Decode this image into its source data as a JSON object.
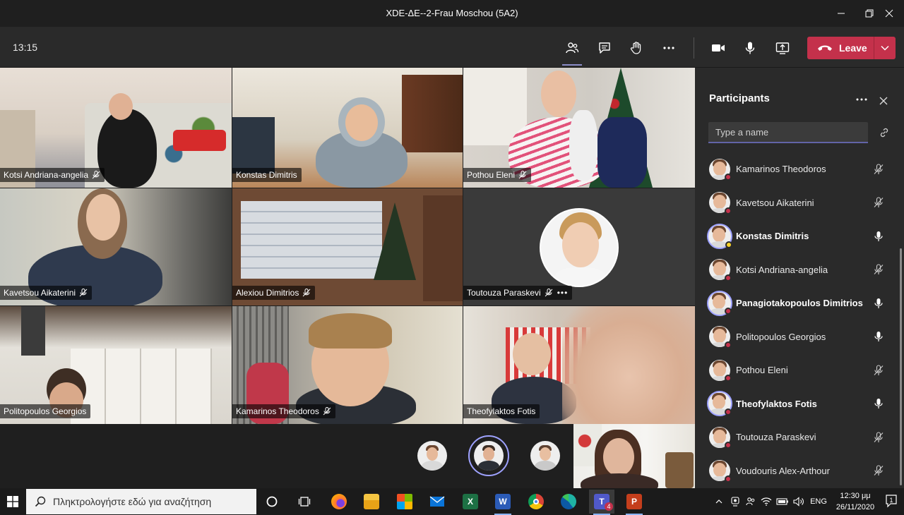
{
  "window": {
    "title": "XDE-ΔΕ--2-Frau Moschou (5A2)"
  },
  "toolbar": {
    "clock": "13:15",
    "leave_label": "Leave"
  },
  "video_tiles": [
    {
      "name": "Kotsi Andriana-angelia"
    },
    {
      "name": "Konstas Dimitris"
    },
    {
      "name": "Pothou Eleni"
    },
    {
      "name": "Kavetsou Aikaterini"
    },
    {
      "name": "Alexiou Dimitrios"
    },
    {
      "name": "Toutouza Paraskevi"
    },
    {
      "name": "Politopoulos Georgios"
    },
    {
      "name": "Kamarinos Theodoros"
    },
    {
      "name": "Theofylaktos Fotis"
    }
  ],
  "panel": {
    "title": "Participants",
    "search_placeholder": "Type a name",
    "participants": [
      {
        "name": "Kamarinos Theodoros",
        "status": "busy",
        "mic": "muted",
        "speaking": false
      },
      {
        "name": "Kavetsou Aikaterini",
        "status": "busy",
        "mic": "muted",
        "speaking": false
      },
      {
        "name": "Konstas Dimitris",
        "status": "away",
        "mic": "on",
        "speaking": true
      },
      {
        "name": "Kotsi Andriana-angelia",
        "status": "busy",
        "mic": "muted",
        "speaking": false
      },
      {
        "name": "Panagiotakopoulos Dimitrios",
        "status": "busy",
        "mic": "on",
        "speaking": true
      },
      {
        "name": "Politopoulos Georgios",
        "status": "busy",
        "mic": "on",
        "speaking": false
      },
      {
        "name": "Pothou Eleni",
        "status": "busy",
        "mic": "muted",
        "speaking": false
      },
      {
        "name": "Theofylaktos Fotis",
        "status": "busy",
        "mic": "on",
        "speaking": true
      },
      {
        "name": "Toutouza Paraskevi",
        "status": "busy",
        "mic": "muted",
        "speaking": false
      },
      {
        "name": "Voudouris Alex-Arthour",
        "status": "busy",
        "mic": "muted",
        "speaking": false
      }
    ]
  },
  "taskbar": {
    "search_placeholder": "Πληκτρολογήστε εδώ για αναζήτηση",
    "teams_badge": "4",
    "language": "ENG",
    "time": "12:30 μμ",
    "date": "26/11/2020",
    "notification_count": "1"
  },
  "colors": {
    "leave": "#c4314b",
    "accent": "#6264a7",
    "ring": "#9ea2ff"
  }
}
